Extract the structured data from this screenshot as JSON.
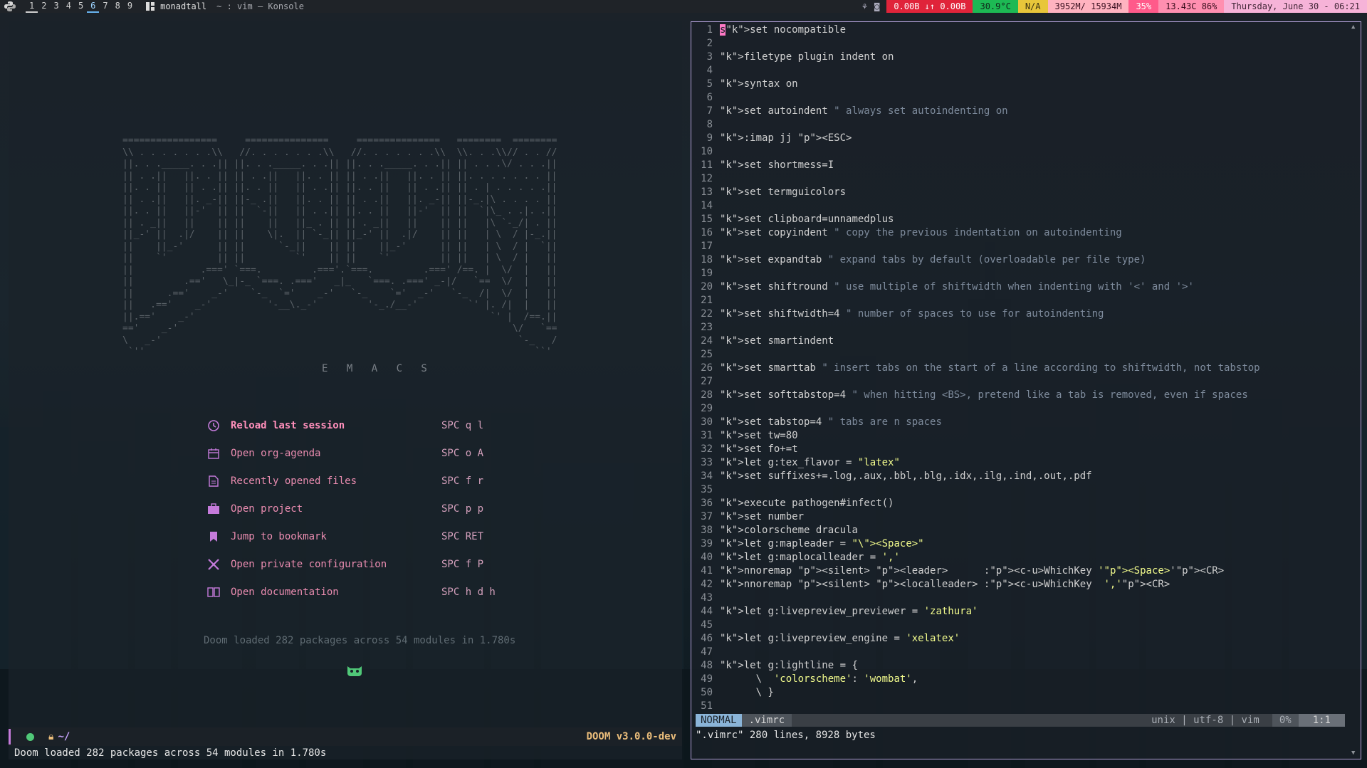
{
  "topbar": {
    "workspaces": [
      "1",
      "2",
      "3",
      "4",
      "5",
      "6",
      "7",
      "8",
      "9"
    ],
    "layout_name": "monadtall",
    "window_title": "~ : vim — Konsole",
    "net_label": "0.00B ↓↑ 0.00B",
    "temp_label": "30.9°C",
    "na_label": "N/A",
    "mem_label": "3952M/ 15934M",
    "vol_label": "35%",
    "bat_label": "13.43C 86%",
    "date_label": "Thursday, June 30 - 06:21"
  },
  "emacs": {
    "banner_word": "E M A C S",
    "menu": [
      {
        "label": "Reload last session",
        "key": "SPC q l",
        "icon": "history-icon"
      },
      {
        "label": "Open org-agenda",
        "key": "SPC o A",
        "icon": "calendar-icon"
      },
      {
        "label": "Recently opened files",
        "key": "SPC f r",
        "icon": "file-icon"
      },
      {
        "label": "Open project",
        "key": "SPC p p",
        "icon": "briefcase-icon"
      },
      {
        "label": "Jump to bookmark",
        "key": "SPC RET",
        "icon": "bookmark-icon"
      },
      {
        "label": "Open private configuration",
        "key": "SPC f P",
        "icon": "tools-icon"
      },
      {
        "label": "Open documentation",
        "key": "SPC h d h",
        "icon": "book-icon"
      }
    ],
    "loaded_msg": "Doom loaded 282 packages across 54 modules in 1.780s",
    "modeline_path": "~/",
    "modeline_version": "DOOM v3.0.0-dev",
    "echo_msg": "Doom loaded 282 packages across 54 modules in 1.780s"
  },
  "vim": {
    "lines": [
      "set nocompatible",
      "",
      "filetype plugin indent on",
      "",
      "syntax on",
      "",
      "set autoindent \" always set autoindenting on",
      "",
      ":imap jj <ESC>",
      "",
      "set shortmess=I",
      "",
      "set termguicolors",
      "",
      "set clipboard=unnamedplus",
      "set copyindent \" copy the previous indentation on autoindenting",
      "",
      "set expandtab \" expand tabs by default (overloadable per file type)",
      "",
      "set shiftround \" use multiple of shiftwidth when indenting with '<' and '>'",
      "",
      "set shiftwidth=4 \" number of spaces to use for autoindenting",
      "",
      "set smartindent",
      "",
      "set smarttab \" insert tabs on the start of a line according to shiftwidth, not tabstop",
      "",
      "set softtabstop=4 \" when hitting <BS>, pretend like a tab is removed, even if spaces",
      "",
      "set tabstop=4 \" tabs are n spaces",
      "set tw=80",
      "set fo+=t",
      "let g:tex_flavor = \"latex\"",
      "set suffixes+=.log,.aux,.bbl,.blg,.idx,.ilg,.ind,.out,.pdf",
      "",
      "execute pathogen#infect()",
      "set number",
      "colorscheme dracula",
      "let g:mapleader = \"\\<Space>\"",
      "let g:maplocalleader = ','",
      "nnoremap <silent> <leader>      :<c-u>WhichKey '<Space>'<CR>",
      "nnoremap <silent> <localleader> :<c-u>WhichKey  ','<CR>",
      "",
      "let g:livepreview_previewer = 'zathura'",
      "",
      "let g:livepreview_engine = 'xelatex'",
      "",
      "let g:lightline = {",
      "      \\  'colorscheme': 'wombat',",
      "      \\ }",
      ""
    ],
    "mode": "NORMAL",
    "filename": ".vimrc",
    "file_info": "unix | utf-8 | vim",
    "percent": "0%",
    "position": "1:1",
    "message": "\".vimrc\" 280 lines, 8928 bytes"
  }
}
